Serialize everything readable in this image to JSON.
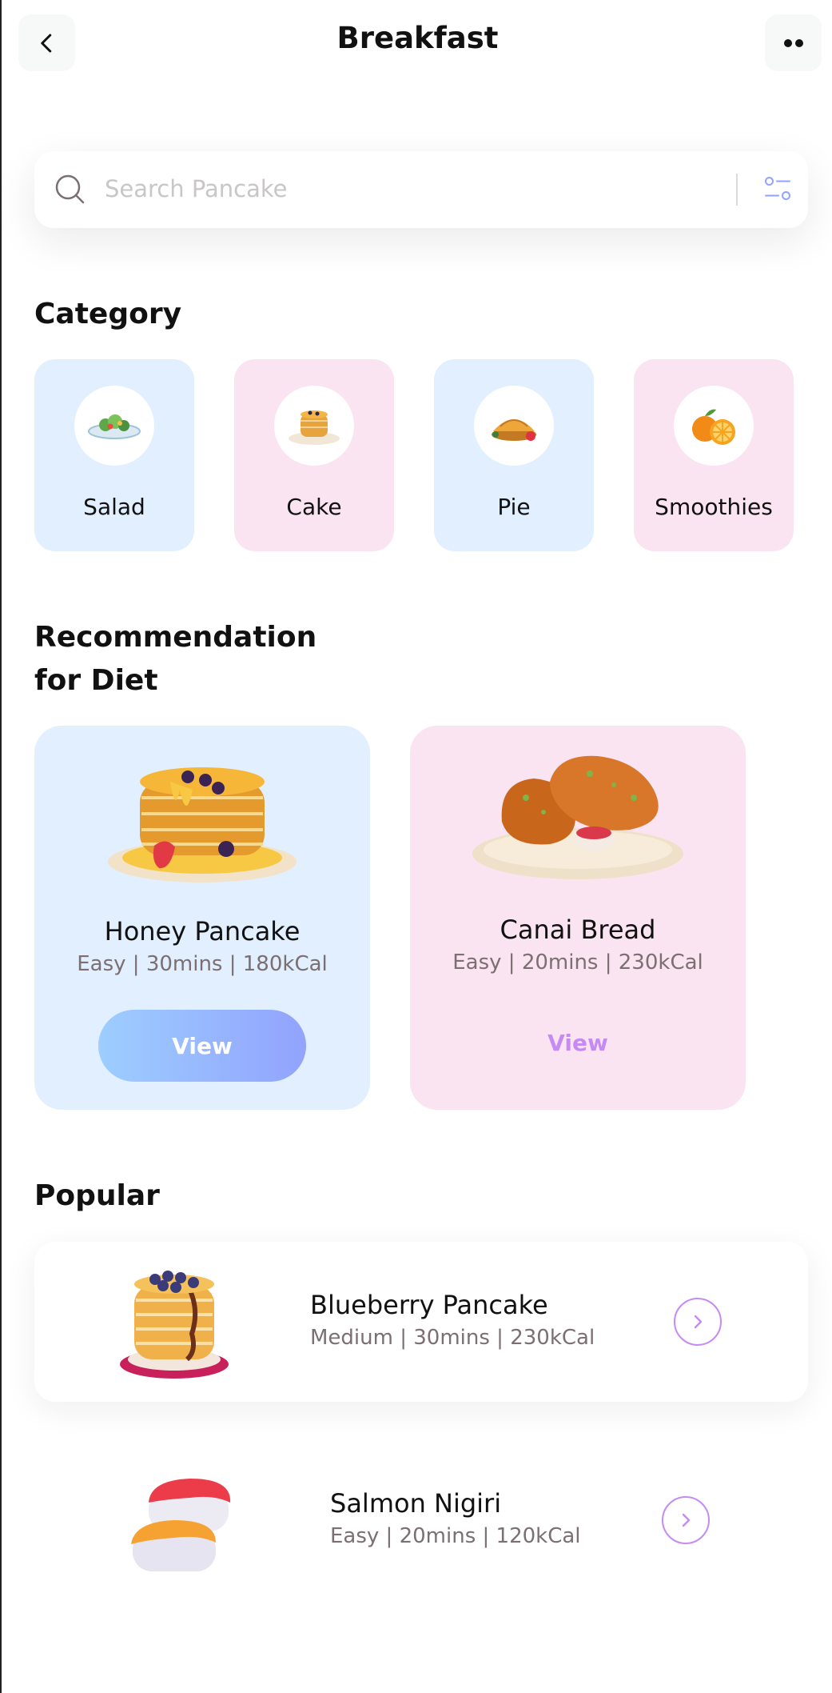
{
  "header": {
    "title": "Breakfast",
    "back_icon": "chevron-left-icon",
    "more_icon": "more-horizontal-icon"
  },
  "search": {
    "placeholder": "Search Pancake",
    "search_icon": "search-icon",
    "filter_icon": "filter-icon"
  },
  "category": {
    "title": "Category",
    "items": [
      {
        "label": "Salad",
        "icon": "salad-icon",
        "bg": "#e2efff"
      },
      {
        "label": "Cake",
        "icon": "pancake-icon",
        "bg": "#fae4f1"
      },
      {
        "label": "Pie",
        "icon": "pie-icon",
        "bg": "#e2efff"
      },
      {
        "label": "Smoothies",
        "icon": "orange-icon",
        "bg": "#fae4f1"
      }
    ]
  },
  "recommendation": {
    "title_line1": "Recommendation",
    "title_line2": "for Diet",
    "items": [
      {
        "name": "Honey Pancake",
        "meta": "Easy | 30mins | 180kCal",
        "action": "View",
        "image": "honey-pancake-image"
      },
      {
        "name": "Canai Bread",
        "meta": "Easy | 20mins | 230kCal",
        "action": "View",
        "image": "canai-bread-image"
      }
    ]
  },
  "popular": {
    "title": "Popular",
    "items": [
      {
        "name": "Blueberry Pancake",
        "meta": "Medium | 30mins | 230kCal",
        "image": "blueberry-pancake-image"
      },
      {
        "name": "Salmon Nigiri",
        "meta": "Easy | 20mins | 120kCal",
        "image": "salmon-nigiri-image"
      }
    ]
  },
  "colors": {
    "accent_gradient_start": "#9dceff",
    "accent_gradient_end": "#92a3fd",
    "purple": "#c58bf2",
    "card_blue": "#e2efff",
    "card_pink": "#fae4f1"
  }
}
